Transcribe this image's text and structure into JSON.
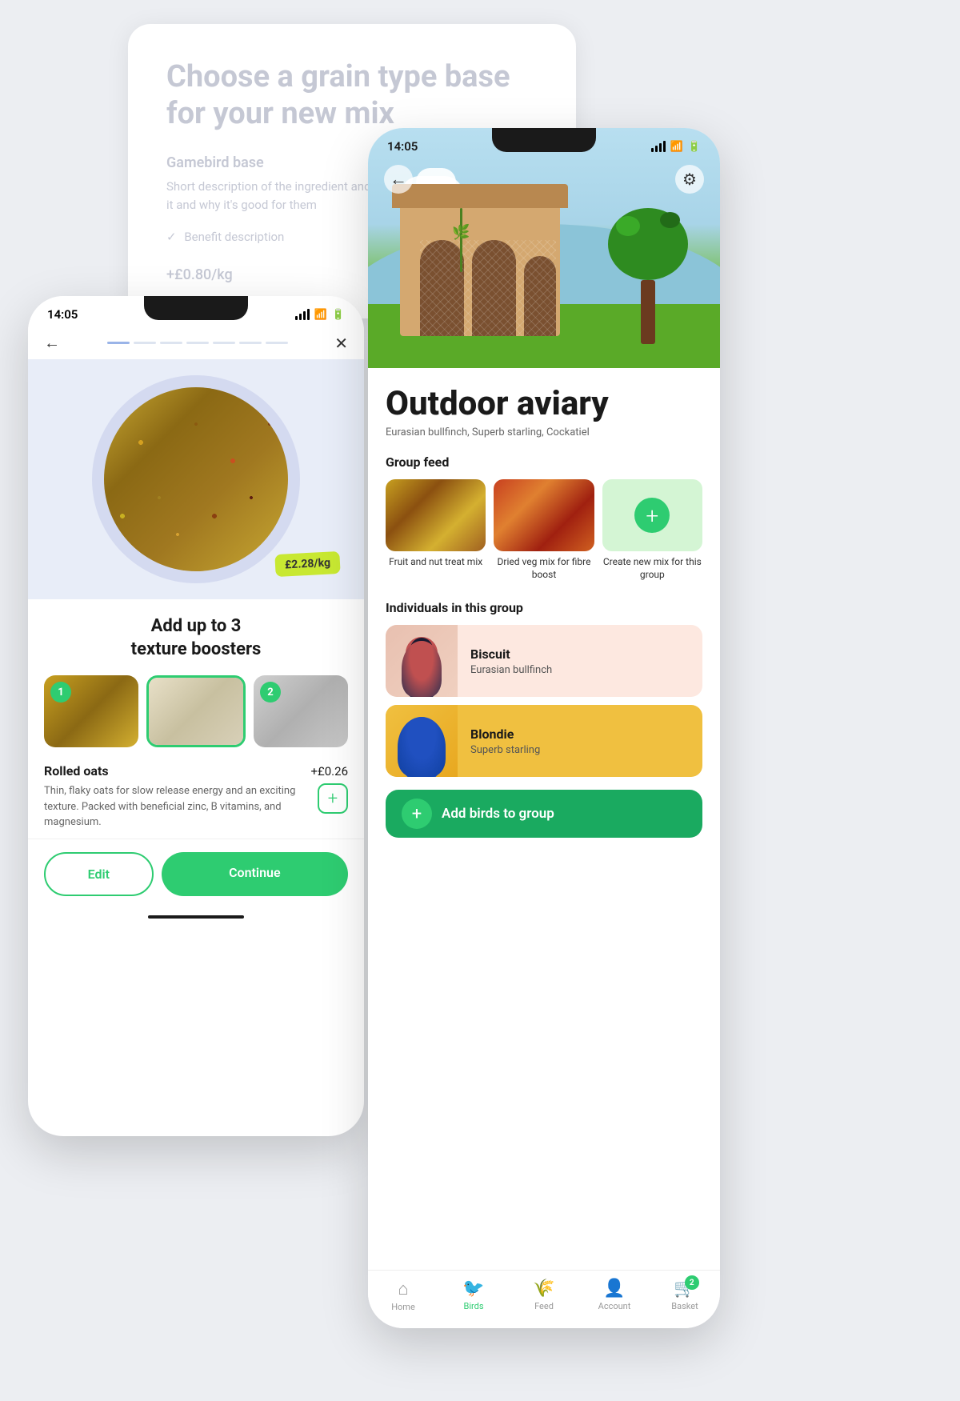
{
  "grain_card": {
    "title": "Choose a grain type base for your new mix",
    "subtitle": "Gamebird base",
    "description": "Short description of the ingredient and its features, e.g. why birds love it and why it's good for them",
    "benefit": "Benefit description",
    "price": "+£0.80/kg"
  },
  "left_phone": {
    "status_time": "14:05",
    "price_tag": "£2.28/kg",
    "boosters_title": "Add up to 3\ntexture boosters",
    "ingredient_name": "Rolled oats",
    "ingredient_price": "+£0.26",
    "ingredient_desc": "Thin, flaky oats for slow release energy and an exciting texture. Packed with beneficial zinc, B vitamins, and magnesium.",
    "btn_edit": "Edit",
    "btn_continue": "Continue",
    "boosters": [
      {
        "badge": "1",
        "selected": false
      },
      {
        "badge": "",
        "selected": true
      },
      {
        "badge": "2",
        "selected": false
      }
    ]
  },
  "right_phone": {
    "status_time": "14:05",
    "aviary_title": "Outdoor aviary",
    "aviary_birds": "Eurasian bullfinch, Superb starling, Cockatiel",
    "group_feed_title": "Group feed",
    "feed_items": [
      {
        "label": "Fruit and nut treat mix"
      },
      {
        "label": "Dried veg mix for fibre boost"
      },
      {
        "label": "Create new mix for this group"
      }
    ],
    "individuals_title": "Individuals in this group",
    "birds": [
      {
        "name": "Biscuit",
        "species": "Eurasian bullfinch"
      },
      {
        "name": "Blondie",
        "species": "Superb starling"
      }
    ],
    "add_birds_label": "Add birds to group",
    "nav_items": [
      {
        "label": "Home",
        "icon": "🏠",
        "active": false
      },
      {
        "label": "Birds",
        "icon": "🐦",
        "active": true
      },
      {
        "label": "Feed",
        "icon": "🌾",
        "active": false
      },
      {
        "label": "Account",
        "icon": "👤",
        "active": false
      },
      {
        "label": "Basket",
        "icon": "🛒",
        "active": false,
        "badge": "2"
      }
    ]
  }
}
